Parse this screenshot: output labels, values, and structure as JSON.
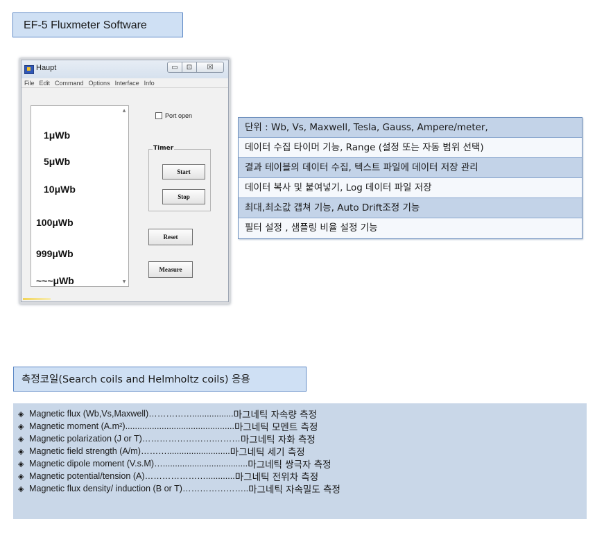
{
  "header": {
    "title": "EF-5 Fluxmeter Software"
  },
  "app_window": {
    "title": "Haupt",
    "window_buttons": {
      "minimize": "▭",
      "restore": "⊡",
      "close": "☒"
    },
    "menu": [
      "File",
      "Edit",
      "Command",
      "Options",
      "Interface",
      "Info"
    ],
    "list_items": [
      "1μWb",
      "5μWb",
      "10μWb",
      "100μWb",
      "999μWb",
      "~~~μWb"
    ],
    "port_open_label": "Port open",
    "timer_label": "Timer",
    "start_label": "Start",
    "stop_label": "Stop",
    "reset_label": "Reset",
    "measure_label": "Measure"
  },
  "features": [
    "단위 : Wb, Vs, Maxwell,  Tesla, Gauss, Ampere/meter,",
    "데이터 수집 타이머 기능, Range (설정 또는 자동 범위 선택)",
    "결과 테이블의 데이터 수집, 텍스트 파일에 데이터 저장 관리",
    "데이터 복사 및 붙여넣기, Log 데이터 파일 저장",
    "최대,최소값 갭쳐 기능, Auto Drift조정 기능",
    "필터 설정 , 샘플링 비율 설정 기능"
  ],
  "coils_section": {
    "title": "측정코일(Search coils and Helmholtz coils) 응용"
  },
  "measurements": [
    {
      "bullet": "◈",
      "en": "Magnetic flux (Wb,Vs,Maxwell) ",
      "dots": "…………….................",
      "ko": "마그네틱 자속량 측정"
    },
    {
      "bullet": "◈",
      "en": "Magnetic moment (A.m²)",
      "dots": ".............................................",
      "ko": "마그네틱 모멘트 측정"
    },
    {
      "bullet": "◈",
      "en": "Magnetic polarization (J or T)",
      "dots": "…………………….………",
      "ko": "마그네틱 자화 측정"
    },
    {
      "bullet": "◈",
      "en": "Magnetic field strength (A/m)",
      "dots": "………..........................",
      "ko": "마그네틱 세기 측정"
    },
    {
      "bullet": "◈",
      "en": "Magnetic dipole moment (V.s.M)",
      "dots": "…...................................",
      "ko": "마그네틱 쌍극자 측정"
    },
    {
      "bullet": "◈",
      "en": "Magnetic potential/tension  (A)",
      "dots": "…………………............",
      "ko": "마그네틱 전위차 측정"
    },
    {
      "bullet": "◈",
      "en": "Magnetic flux density/ induction (B or T)",
      "dots": "………………….. ",
      "ko": "마그네틱 자속밀도 측정"
    }
  ],
  "colors": {
    "title_fill": "#cfe0f4",
    "title_border": "#5b87c5",
    "row_shaded": "#c3d3e8",
    "panel": "#c9d7e8"
  }
}
